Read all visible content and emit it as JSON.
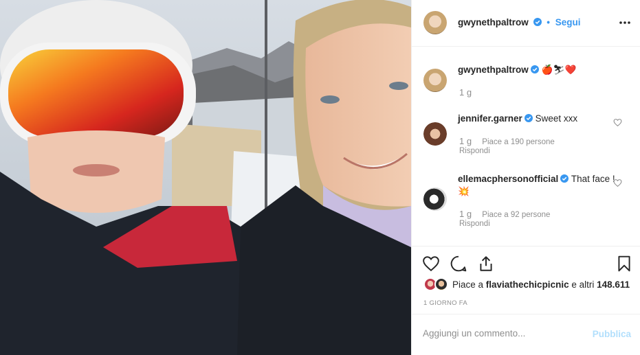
{
  "post": {
    "photo_alt": "selfie on ski lift",
    "author": "gwynethpaltrow",
    "follow_label": "Segui",
    "dot": "•",
    "caption_emoji": "🍎⛷❤️",
    "caption_time": "1 g"
  },
  "comments": [
    {
      "user": "jennifer.garner",
      "text": "Sweet xxx",
      "time": "1 g",
      "likes": "Piace a 190 persone",
      "reply": "Rispondi"
    },
    {
      "user": "ellemacphersonofficial",
      "text": "That face ! 💥",
      "time": "1 g",
      "likes": "Piace a 92 persone",
      "reply": "Rispondi"
    }
  ],
  "likes": {
    "prefix": "Piace a ",
    "user": "flaviathechicpicnic",
    "suffix": " e altri ",
    "count": "148.611"
  },
  "timestamp": "1 GIORNO FA",
  "comment_input": {
    "placeholder": "Aggiungi un commento...",
    "publish_label": "Pubblica"
  },
  "colors": {
    "link_blue": "#3897f0",
    "publish_disabled": "#b2dffc",
    "meta_gray": "#8e8e8e"
  },
  "icons": [
    "verified-badge-icon",
    "more-options-icon",
    "heart-icon",
    "comment-icon",
    "share-icon",
    "bookmark-icon"
  ]
}
